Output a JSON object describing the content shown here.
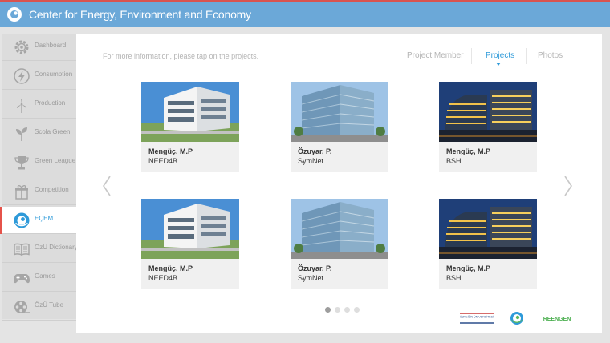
{
  "app": {
    "title": "Center for Energy, Environment and Economy"
  },
  "sidebar": {
    "items": [
      {
        "label": "Dashboard",
        "icon": "gear-icon",
        "active": false
      },
      {
        "label": "Consumption",
        "icon": "lightning-icon",
        "active": false
      },
      {
        "label": "Production",
        "icon": "wind-turbine-icon",
        "active": false
      },
      {
        "label": "Scola Green",
        "icon": "sprout-icon",
        "active": false
      },
      {
        "label": "Green League",
        "icon": "trophy-icon",
        "active": false
      },
      {
        "label": "Competition",
        "icon": "gift-icon",
        "active": false
      },
      {
        "label": "EÇEM",
        "icon": "ecem-logo-icon",
        "active": true
      },
      {
        "label": "ÖzÜ Dictionary",
        "icon": "book-icon",
        "active": false
      },
      {
        "label": "Games",
        "icon": "gamepad-icon",
        "active": false
      },
      {
        "label": "ÖzÜ Tube",
        "icon": "film-reel-icon",
        "active": false
      }
    ]
  },
  "main": {
    "hint": "For more information, please tap on the projects.",
    "tabs": [
      {
        "label": "Project Member",
        "active": false
      },
      {
        "label": "Projects",
        "active": true
      },
      {
        "label": "Photos",
        "active": false
      }
    ],
    "cards": [
      {
        "name": "Mengüç, M.P",
        "project": "NEED4B",
        "photo": "white-building-photo"
      },
      {
        "name": "Özuyar, P.",
        "project": "SymNet",
        "photo": "glass-office-photo"
      },
      {
        "name": "Mengüç, M.P",
        "project": "BSH",
        "photo": "night-building-photo"
      },
      {
        "name": "Mengüç, M.P",
        "project": "NEED4B",
        "photo": "white-building-photo"
      },
      {
        "name": "Özuyar, P.",
        "project": "SymNet",
        "photo": "glass-office-photo"
      },
      {
        "name": "Mengüç, M.P",
        "project": "BSH",
        "photo": "night-building-photo"
      }
    ],
    "pagination": {
      "pages": 4,
      "current": 1
    }
  },
  "footer": {
    "logos": [
      {
        "text": "ÖZYEĞİN ÜNİVERSİTESİ",
        "name": "ozyegin-university-logo"
      },
      {
        "text": "",
        "name": "ecem-logo"
      },
      {
        "text": "REENGEN",
        "name": "reengen-logo"
      }
    ]
  },
  "colors": {
    "topbar": "#6ba8d8",
    "accent": "#2e9ad9",
    "active_marker": "#e5524a",
    "sidebar": "#dcdcdc"
  }
}
